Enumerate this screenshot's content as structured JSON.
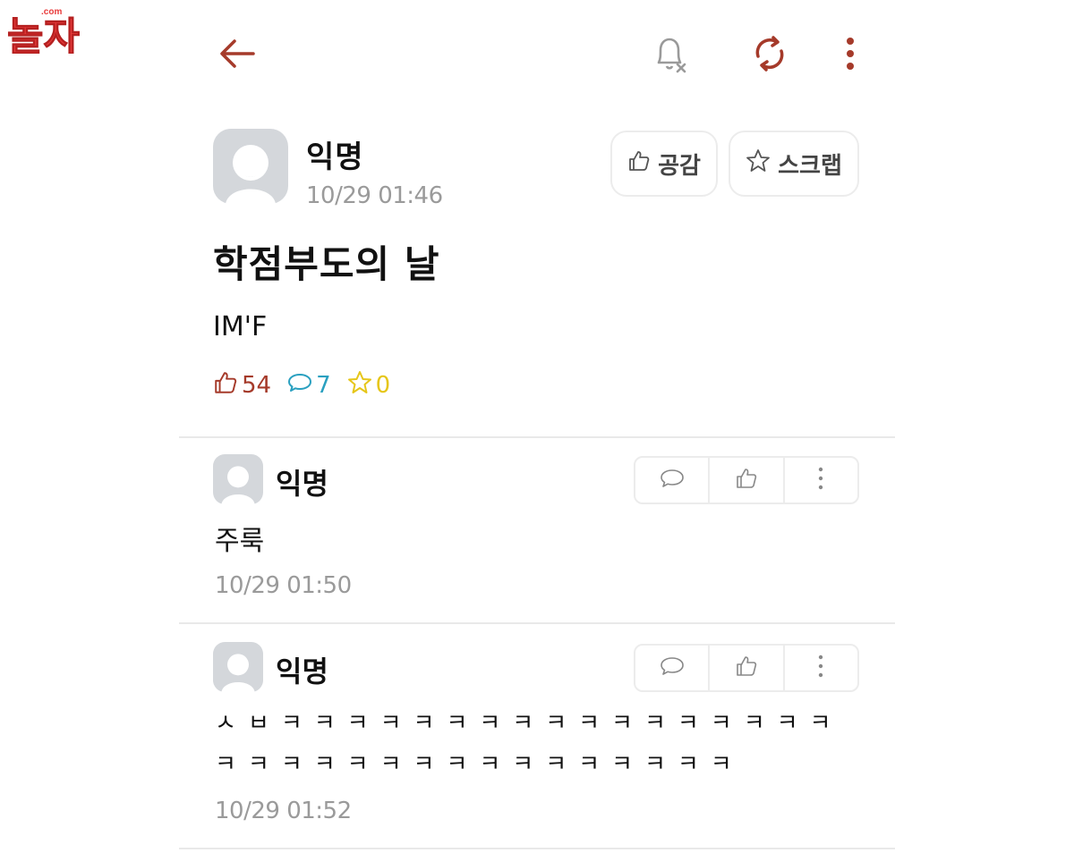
{
  "watermark": {
    "text": "놀자",
    "sub": ".com"
  },
  "post": {
    "author": "익명",
    "time": "10/29 01:46",
    "like_label": "공감",
    "scrap_label": "스크랩",
    "title": "학점부도의 날",
    "body": "IM'F",
    "stats": {
      "likes": "54",
      "comments": "7",
      "scraps": "0"
    }
  },
  "comments": [
    {
      "author": "익명",
      "text": "주룩",
      "time": "10/29 01:50"
    },
    {
      "author": "익명",
      "text": "ㅅㅂㅋㅋㅋㅋㅋㅋㅋㅋㅋㅋㅋㅋㅋㅋㅋㅋㅋㅋㅋㅋㅋㅋㅋㅋㅋㅋㅋㅋㅋㅋㅋㅋㅋ",
      "time": "10/29 01:52"
    }
  ],
  "colors": {
    "accent": "#a53a2a",
    "comment": "#2aa0c0",
    "scrap": "#e6c619",
    "watermark": "#e83a3a"
  }
}
